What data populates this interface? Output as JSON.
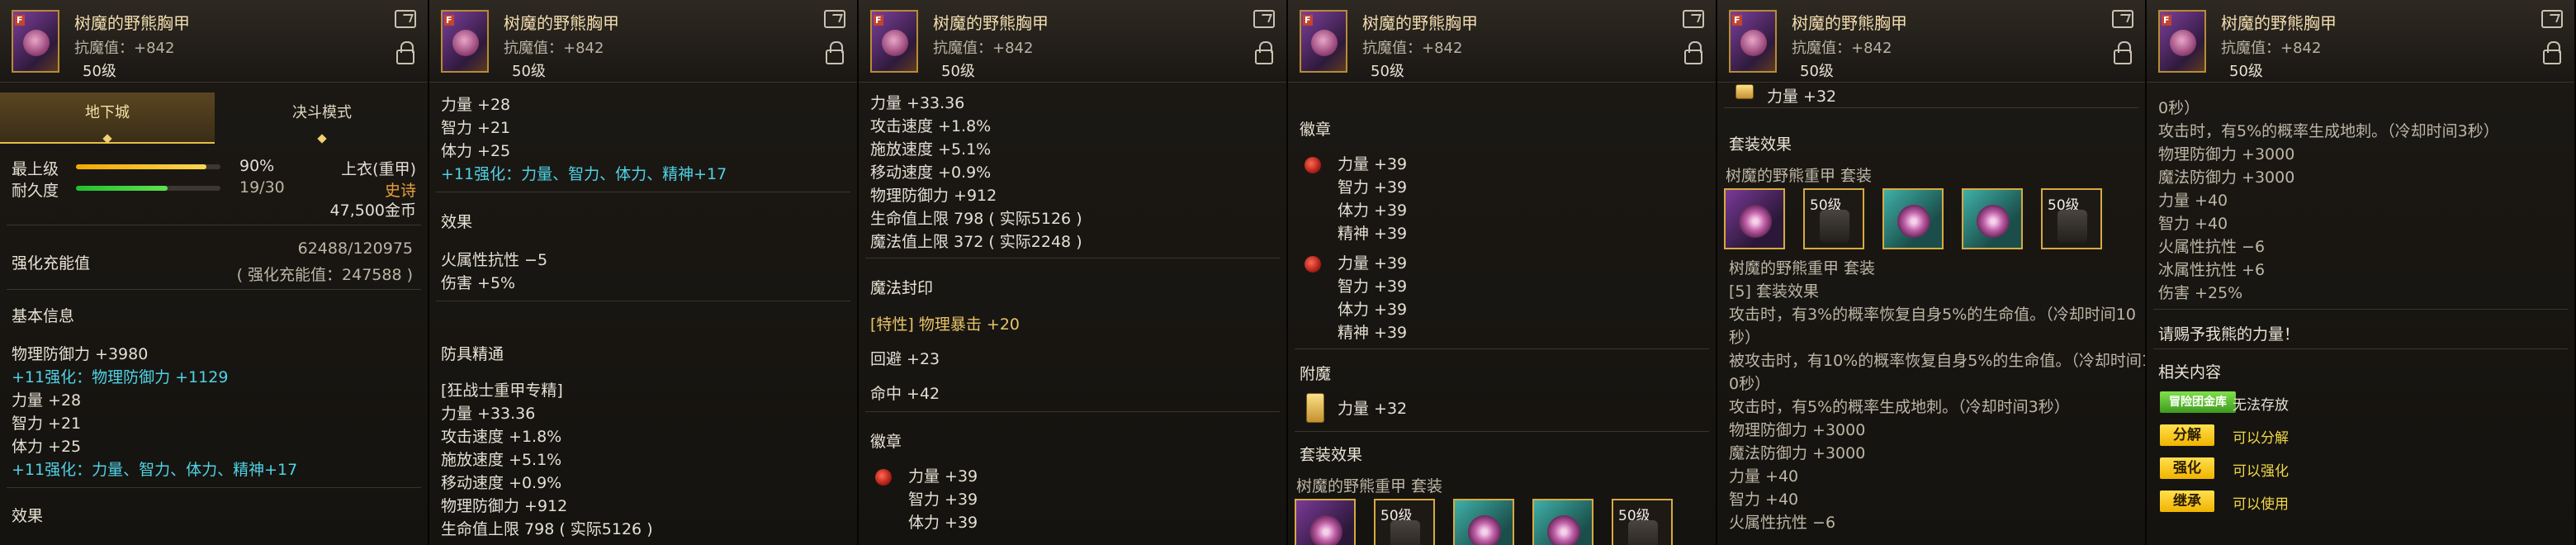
{
  "item": {
    "name": "树魔的野熊胸甲",
    "resistance": "抗魔值：+842",
    "level": "50级",
    "icon_tag": "F"
  },
  "panel1": {
    "tabs": [
      "地下城",
      "决斗模式"
    ],
    "top_grade_label": "最上级",
    "top_grade_pct": "90%",
    "grade_fill": 0.9,
    "durability_label": "耐久度",
    "durability_value": "19/30",
    "durability_fill": 0.633,
    "armor_type": "上衣(重甲)",
    "rarity": "史诗",
    "price": "47,500金币",
    "enhance_label": "强化充能值",
    "enhance_value": "62488/120975",
    "enhance_note": "( 强化充能值：247588 )",
    "basic_info": "基本信息",
    "phys_def": "物理防御力 +3980",
    "plus11_def": "+11强化：物理防御力 +1129",
    "str": "力量 +28",
    "int": "智力 +21",
    "vit": "体力 +25",
    "plus11_all": "+11强化：力量、智力、体力、精神+17",
    "effects": "效果"
  },
  "panel2": {
    "str": "力量 +28",
    "int": "智力 +21",
    "vit": "体力 +25",
    "plus11_all": "+11强化：力量、智力、体力、精神+17",
    "effects": "效果",
    "fire_res": "火属性抗性 −5",
    "damage": "伤害 +5%",
    "mastery": "防具精通",
    "mastery_type": "[狂战士重甲专精]",
    "m_str": "力量 +33.36",
    "m_atk": "攻击速度 +1.8%",
    "m_cast": "施放速度 +5.1%",
    "m_move": "移动速度 +0.9%",
    "m_def": "物理防御力 +912",
    "m_hp": "生命值上限 798 ( 实际5126 )"
  },
  "panel3": {
    "m_str": "力量 +33.36",
    "m_atk": "攻击速度 +1.8%",
    "m_cast": "施放速度 +5.1%",
    "m_move": "移动速度 +0.9%",
    "m_def": "物理防御力 +912",
    "m_hp": "生命值上限 798 ( 实际5126 )",
    "m_mp": "魔法值上限 372 ( 实际2248 )",
    "magic_seal": "魔法封印",
    "trait": "[特性] 物理暴击 +20",
    "evade": "回避 +23",
    "hit": "命中 +42",
    "emblem": "徽章",
    "e_str": "力量 +39",
    "e_int": "智力 +39",
    "e_vit": "体力 +39"
  },
  "panel4": {
    "emblem": "徽章",
    "e1": [
      "力量 +39",
      "智力 +39",
      "体力 +39",
      "精神 +39"
    ],
    "e2": [
      "力量 +39",
      "智力 +39",
      "体力 +39",
      "精神 +39"
    ],
    "enchant": "附魔",
    "enchant_val": "力量 +32",
    "set_effect": "套装效果",
    "set_name": "树魔的野熊重甲  套装",
    "set_levels": [
      "50级",
      "50级"
    ]
  },
  "panel5": {
    "top_val": "力量 +32",
    "set_effect": "套装效果",
    "set_name": "树魔的野熊重甲  套装",
    "set_levels": [
      "50级",
      "50级"
    ],
    "set_name2": "树魔的野熊重甲  套装",
    "set5": "[5] 套装效果",
    "d1a": "攻击时，有3%的概率恢复自身5%的生命值。（冷却时间10",
    "d1b": "秒）",
    "d2a": "被攻击时，有10%的概率恢复自身5%的生命值。（冷却时间1",
    "d2b": "0秒）",
    "d3": "攻击时，有5%的概率生成地刺。（冷却时间3秒）",
    "pdef": "物理防御力 +3000",
    "mdef": "魔法防御力 +3000",
    "str": "力量 +40",
    "int": "智力 +40",
    "fire": "火属性抗性 −6"
  },
  "panel6": {
    "d0": "0秒）",
    "d3": "攻击时，有5%的概率生成地刺。（冷却时间3秒）",
    "pdef": "物理防御力 +3000",
    "mdef": "魔法防御力 +3000",
    "str": "力量 +40",
    "int": "智力 +40",
    "fire": "火属性抗性 −6",
    "water": "冰属性抗性 +6",
    "dmg": "伤害 +25%",
    "quote": "请赐予我熊的力量！",
    "related": "相关内容",
    "vault_btn": "冒险团金库",
    "vault_val": "无法存放",
    "decompose_btn": "分解",
    "decompose_val": "可以分解",
    "enhance_btn": "强化",
    "enhance_val": "可以强化",
    "inherit_btn": "继承",
    "inherit_val": "可以使用"
  }
}
